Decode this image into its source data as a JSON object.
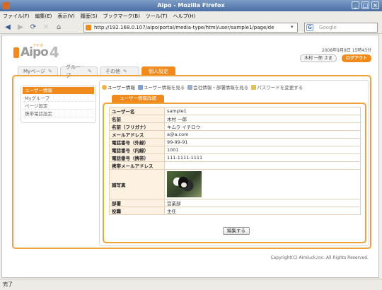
{
  "window": {
    "title": "Aipo - Mozilla Firefox"
  },
  "menubar": [
    "ファイル(F)",
    "編集(E)",
    "表示(V)",
    "履歴(S)",
    "ブックマーク(B)",
    "ツール(T)",
    "ヘルプ(H)"
  ],
  "browser": {
    "url": "http://192.168.0.107/aipo/portal/media-type/html/user/sample1/page/de",
    "search_placeholder": "Google"
  },
  "header": {
    "logo_text": "Aipo",
    "logo_version": "4",
    "logo_kana": "アイポ",
    "date": "2008年9月8日 15時43分",
    "user_label": "木村 一郎 さま",
    "logout_label": "ログアウト"
  },
  "tabs": [
    {
      "label": "Myページ"
    },
    {
      "label": "グループ"
    },
    {
      "label": "その他"
    },
    {
      "label": "個人設定"
    }
  ],
  "left_menu": [
    "ユーザー情報",
    "Myグループ",
    "ページ設定",
    "携帯電話設定"
  ],
  "subnav": [
    "ユーザー情報",
    "ユーザー情報を見る",
    "会社情報・部署情報を見る",
    "パスワードを変更する"
  ],
  "detail_tab_label": "ユーザー情報詳細",
  "user_info": [
    {
      "key": "ユーザー名",
      "value": "sample1"
    },
    {
      "key": "名前",
      "value": "木村 一郎"
    },
    {
      "key": "名前（フリガナ）",
      "value": "キムラ イチロウ"
    },
    {
      "key": "メールアドレス",
      "value": "a@a.com"
    },
    {
      "key": "電話番号（外線）",
      "value": "99-99-91"
    },
    {
      "key": "電話番号（内線）",
      "value": "1001"
    },
    {
      "key": "電話番号（携帯）",
      "value": "111-1111-1111"
    },
    {
      "key": "携帯メールアドレス",
      "value": ""
    },
    {
      "key": "顔写真",
      "value": ""
    },
    {
      "key": "部署",
      "value": "営業部"
    },
    {
      "key": "役職",
      "value": "主任"
    }
  ],
  "edit_button_label": "編集する",
  "copyright": "Copyright(C) Aimluck,Inc. All Rights Reserved.",
  "status": "完了",
  "colors": {
    "accent": "#f08a1c"
  }
}
